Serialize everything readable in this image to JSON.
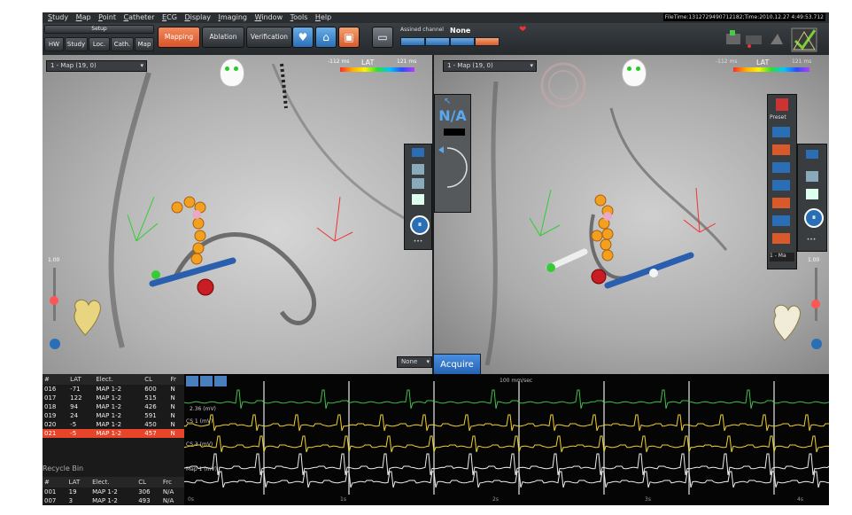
{
  "menu": [
    "Study",
    "Map",
    "Point",
    "Catheter",
    "ECG",
    "Display",
    "Imaging",
    "Window",
    "Tools",
    "Help"
  ],
  "file_info": "FileTime:1312729490712182;Time:2010.12.27 4:49:53.712",
  "setup": {
    "label": "Setup",
    "buttons": [
      "HW",
      "Study",
      "Loc.",
      "Cath.",
      "Map"
    ]
  },
  "tabs": [
    "Mapping",
    "Ablation",
    "Verification"
  ],
  "assigned_channel": {
    "label": "Assined channel",
    "value": "None",
    "chips": [
      "",
      "",
      "",
      ""
    ]
  },
  "left_view": {
    "map_name": "1 - Map (19, 0)",
    "lat_label": "LAT",
    "lat_min": "-112 ms",
    "lat_max": "121 ms",
    "zoom": "1.00",
    "view_select": "None"
  },
  "right_view": {
    "map_name": "1 - Map (19, 0)",
    "lat_label": "LAT",
    "lat_min": "-112 ms",
    "lat_max": "121 ms",
    "zoom": "1.00",
    "na_label": "N/A",
    "preset_label": "Preset",
    "bottom_sel": "1 - Ma"
  },
  "acquire_label": "Acquire",
  "point_table": {
    "headers": [
      "#",
      "LAT",
      "Elect.",
      "CL",
      "Fr"
    ],
    "rows": [
      {
        "id": "016",
        "lat": "-71",
        "elect": "MAP 1-2",
        "cl": "600",
        "fr": "N"
      },
      {
        "id": "017",
        "lat": "122",
        "elect": "MAP 1-2",
        "cl": "515",
        "fr": "N"
      },
      {
        "id": "018",
        "lat": "94",
        "elect": "MAP 1-2",
        "cl": "426",
        "fr": "N"
      },
      {
        "id": "019",
        "lat": "24",
        "elect": "MAP 1-2",
        "cl": "591",
        "fr": "N"
      },
      {
        "id": "020",
        "lat": "-5",
        "elect": "MAP 1-2",
        "cl": "450",
        "fr": "N"
      },
      {
        "id": "021",
        "lat": "-5",
        "elect": "MAP 1-2",
        "cl": "457",
        "fr": "N"
      }
    ]
  },
  "recycle_bin": {
    "title": "Recycle Bin",
    "headers": [
      "#",
      "LAT",
      "Elect.",
      "CL",
      "Frc"
    ],
    "rows": [
      {
        "id": "001",
        "lat": "19",
        "elect": "MAP 1-2",
        "cl": "306",
        "fr": "N/A"
      },
      {
        "id": "007",
        "lat": "3",
        "elect": "MAP 1-2",
        "cl": "493",
        "fr": "N/A"
      }
    ]
  },
  "ecg": {
    "speed": "100 mm/sec",
    "lead_labels": [
      "2.36 (mV)",
      "CS 1 (mV)",
      "CS 3 (mV)",
      "Map 1 (mV)"
    ],
    "time_ticks": [
      "0s",
      "1s",
      "2s",
      "3s",
      "4s"
    ]
  },
  "colors": {
    "accent": "#e85a2a",
    "selected_row": "#e8442a",
    "blue": "#2a6fb6"
  }
}
